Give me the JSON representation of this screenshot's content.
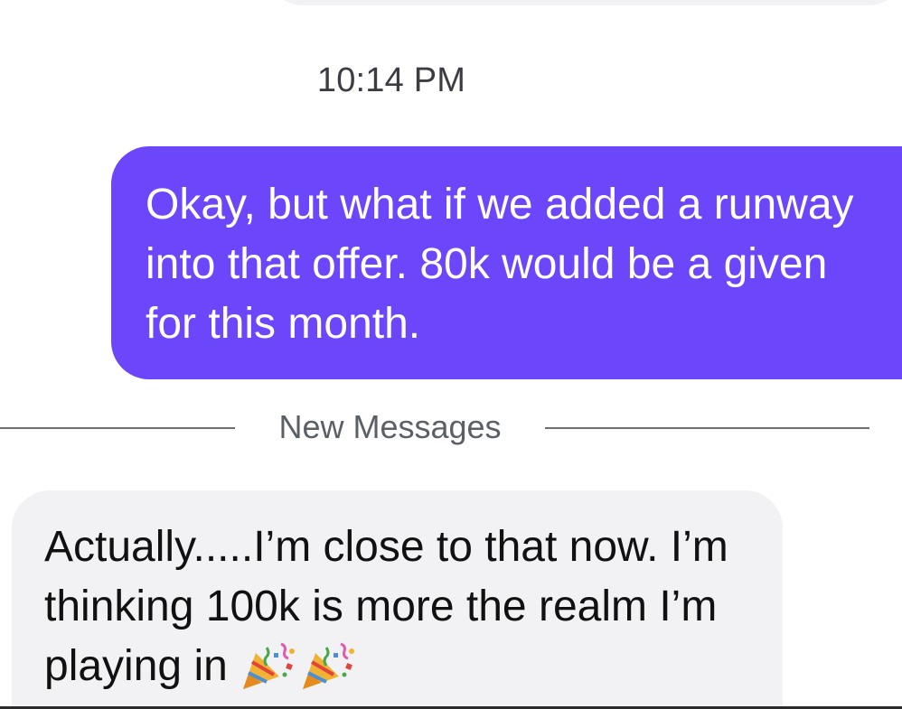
{
  "conversation": {
    "timestamp": "10:14 PM",
    "outgoing_message": "Okay, but what if we added a runway into that offer. 80k would be a given for this month.",
    "divider_label": "New Messages",
    "incoming_message": {
      "text": "Actually.....I’m close to that now. I’m thinking 100k is more the realm I’m playing in",
      "emojis": [
        "party-popper-icon",
        "party-popper-icon"
      ]
    }
  },
  "colors": {
    "outgoing_bubble": "#6b46fb",
    "incoming_bubble": "#f2f2f4",
    "timestamp_text": "#3c3c43",
    "divider": "#6f6f73"
  }
}
